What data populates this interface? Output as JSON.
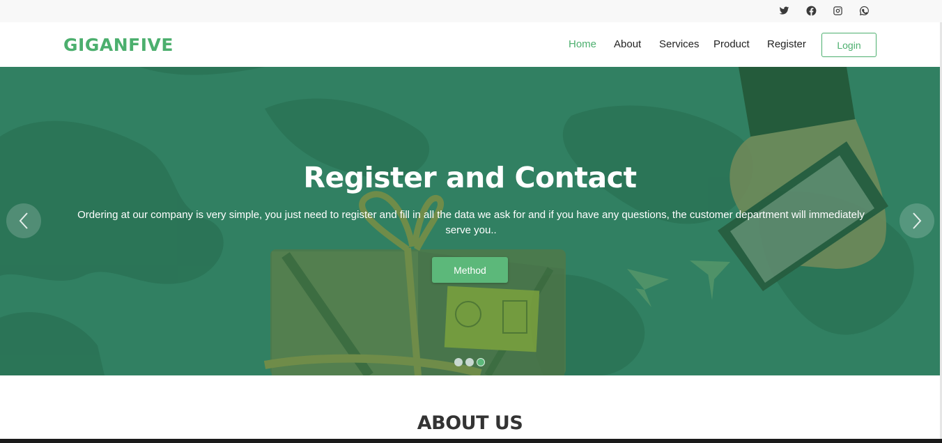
{
  "topbar": {
    "social": [
      {
        "icon": "twitter-icon"
      },
      {
        "icon": "facebook-icon"
      },
      {
        "icon": "instagram-icon"
      },
      {
        "icon": "whatsapp-icon"
      }
    ]
  },
  "navbar": {
    "logo": "GIGANFIVE",
    "links": [
      {
        "label": "Home",
        "active": true
      },
      {
        "label": "About"
      },
      {
        "label": "Services"
      },
      {
        "label": "Product"
      },
      {
        "label": "Register"
      }
    ],
    "login_label": "Login"
  },
  "hero": {
    "title": "Register and Contact",
    "subtitle": "Ordering at our company is very simple, you just need to register and fill in all the data we ask for and if you have any questions, the customer department will immediately serve you..",
    "button_label": "Method",
    "overlay_color": "#318062",
    "accent_color": "#5cb87a",
    "slides": 3,
    "active_slide": 3
  },
  "about": {
    "title": "ABOUT US"
  },
  "colors": {
    "brand": "#4caf6e"
  }
}
